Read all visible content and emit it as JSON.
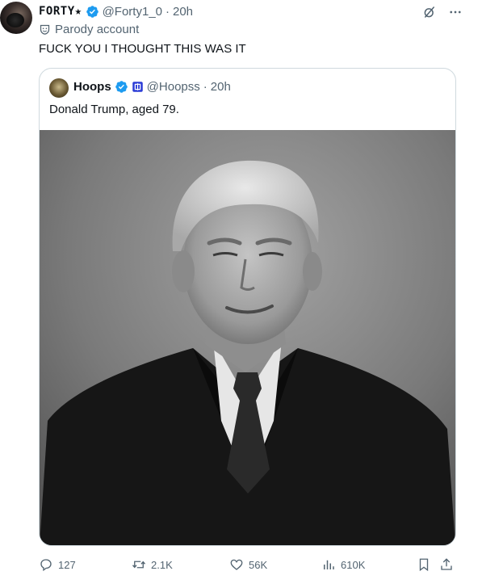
{
  "post": {
    "display_name": "FORTY★",
    "handle": "@Forty1_0",
    "separator": "·",
    "time": "20h",
    "parody_label": "Parody account",
    "text": "FUCK YOU I THOUGHT THIS WAS IT"
  },
  "quoted": {
    "display_name": "Hoops",
    "handle": "@Hoopss",
    "separator": "·",
    "time": "20h",
    "text": "Donald Trump, aged 79."
  },
  "actions": {
    "replies": "127",
    "reposts": "2.1K",
    "likes": "56K",
    "views": "610K"
  },
  "icons": {
    "verified": "verified-badge-icon",
    "affiliate": "affiliate-badge-icon",
    "parody": "parody-mask-icon",
    "grok": "grok-icon",
    "more": "more-icon",
    "reply": "reply-icon",
    "repost": "repost-icon",
    "like": "like-icon",
    "views": "views-icon",
    "bookmark": "bookmark-icon",
    "share": "share-icon"
  },
  "colors": {
    "verified_blue": "#1d9bf0",
    "secondary_text": "#536471",
    "border": "#cfd9de"
  }
}
